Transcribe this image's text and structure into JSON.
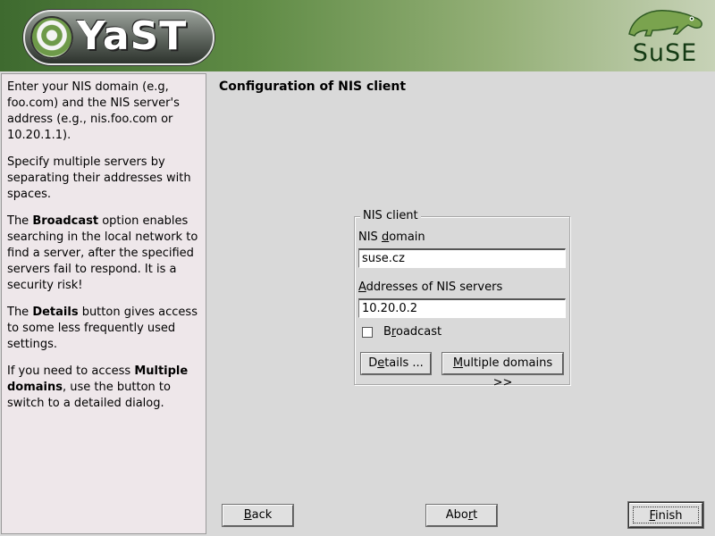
{
  "header": {
    "app_logo_text": "YaST",
    "brand_logo_text": "SuSE"
  },
  "help": {
    "p1": "Enter your NIS domain (e.g, foo.com) and the NIS server's address (e.g., nis.foo.com or 10.20.1.1).",
    "p2": "Specify multiple servers by separating their addresses with spaces.",
    "p3_pre": "The ",
    "p3_bold": "Broadcast",
    "p3_post": " option enables searching in the local network to find a server, after the specified servers fail to respond. It is a security risk!",
    "p4_pre": "The ",
    "p4_bold": "Details",
    "p4_post": " button gives access to some less frequently used settings.",
    "p5_pre": "If you need to access ",
    "p5_bold": "Multiple domains",
    "p5_post": ", use the button to switch to a detailed dialog."
  },
  "dialog": {
    "title": "Configuration of NIS client"
  },
  "nis_client": {
    "group_label": "NIS client",
    "domain_label_pre": "NIS ",
    "domain_label_hot": "d",
    "domain_label_post": "omain",
    "domain_value": "suse.cz",
    "servers_label_hot": "A",
    "servers_label_post": "ddresses of NIS servers",
    "servers_value": "10.20.0.2",
    "broadcast_label_pre": "B",
    "broadcast_label_hot": "r",
    "broadcast_label_post": "oadcast",
    "broadcast_checked": false,
    "details_label_pre": "D",
    "details_label_hot": "e",
    "details_label_post": "tails ...",
    "multiple_label_hot": "M",
    "multiple_label_post": "ultiple domains >>"
  },
  "footer": {
    "back_hot": "B",
    "back_post": "ack",
    "abort_pre": "Abo",
    "abort_hot": "r",
    "abort_post": "t",
    "finish_hot": "F",
    "finish_post": "inish"
  },
  "colors": {
    "banner_dark": "#3e6a2f",
    "banner_light": "#c7d2b7",
    "help_bg": "#eee7ea",
    "window_bg": "#d9d9d9"
  }
}
